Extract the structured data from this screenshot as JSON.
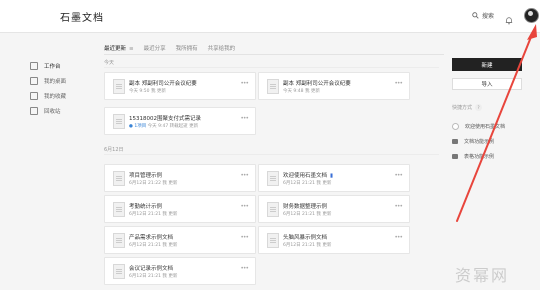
{
  "app": {
    "logo": "石墨文档"
  },
  "topbar": {
    "search_label": "搜索"
  },
  "sidebar": {
    "items": [
      {
        "label": "工作台",
        "active": true
      },
      {
        "label": "我的桌面",
        "active": false
      },
      {
        "label": "我的收藏",
        "active": false
      },
      {
        "label": "回收站",
        "active": false
      }
    ]
  },
  "tabs": [
    {
      "label": "最近更新",
      "active": true
    },
    {
      "label": "最近分享",
      "active": false
    },
    {
      "label": "我所拥有",
      "active": false
    },
    {
      "label": "共享给我的",
      "active": false
    }
  ],
  "sections": {
    "today": "今天",
    "date": "6月12日"
  },
  "cards": [
    {
      "title": "副本 郑副利司公开会议纪要",
      "meta": "今天 9:50 我 更新"
    },
    {
      "title": "副本 郑副利司公开会议纪要",
      "meta": "今天 9:48 我 更新"
    },
    {
      "title": "15318002围聚支付式需记录",
      "meta_prefix": "● 1项目",
      "meta": "今天 9:47 转载起逝 更新"
    },
    {
      "title": "项目管理示例",
      "meta": "6月12日 21:22 我 更新"
    },
    {
      "title": "欢迎使用石墨文档",
      "meta": "6月12日 21:21 我 更新",
      "flag": true
    },
    {
      "title": "考勤统计示例",
      "meta": "6月12日 21:21 我 更新"
    },
    {
      "title": "财务数据整理示例",
      "meta": "6月12日 21:21 我 更新"
    },
    {
      "title": "产品需求示例文档",
      "meta": "6月12日 21:21 我 更新"
    },
    {
      "title": "头脑风暴示例文档",
      "meta": "6月12日 21:21 我 更新"
    },
    {
      "title": "会议记录示例文档",
      "meta": "6月12日 21:21 我 更新"
    }
  ],
  "right_panel": {
    "new_button": "新建",
    "import_button": "导入",
    "shortcut_title": "快捷方式",
    "shortcut_help": "?",
    "shortcuts": [
      {
        "label": "欢迎使用石墨文档",
        "icon": "circle"
      },
      {
        "label": "文档功能示例",
        "icon": "folder"
      },
      {
        "label": "表格功能示例",
        "icon": "folder"
      }
    ]
  },
  "watermark": "资幂网",
  "colors": {
    "arrow": "#e8453c",
    "primary_button": "#222222"
  }
}
